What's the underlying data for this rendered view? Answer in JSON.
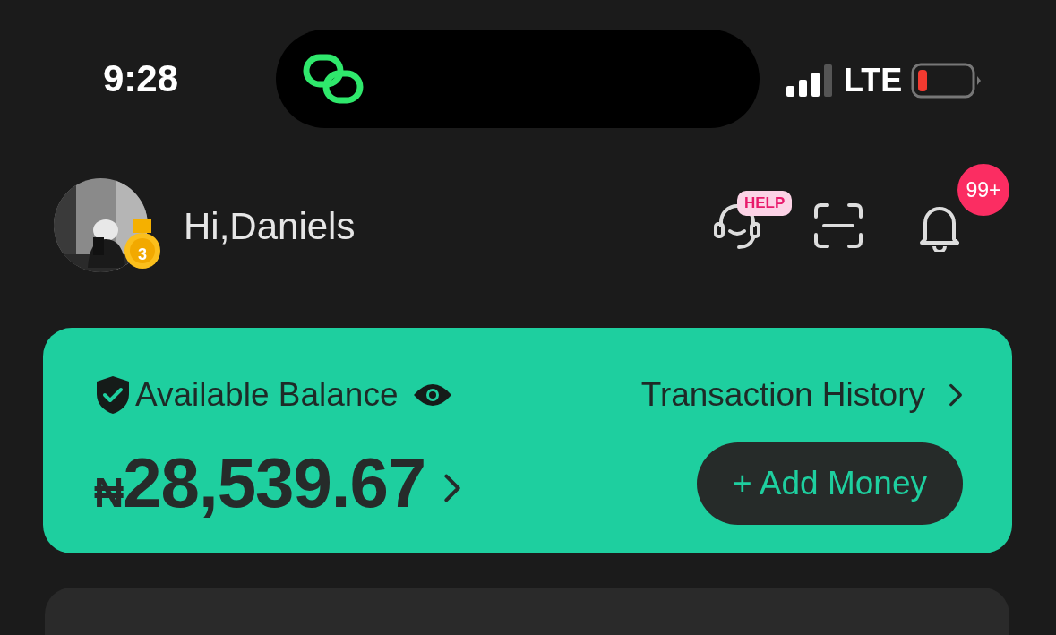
{
  "status_bar": {
    "time": "9:28",
    "network": "LTE"
  },
  "header": {
    "greeting": "Hi,Daniels",
    "level_badge": "3",
    "help_badge": "HELP",
    "notification_count": "99+"
  },
  "balance_card": {
    "label": "Available Balance",
    "history_link": "Transaction History",
    "currency": "₦",
    "amount": "28,539.67",
    "add_button": "+ Add Money"
  }
}
